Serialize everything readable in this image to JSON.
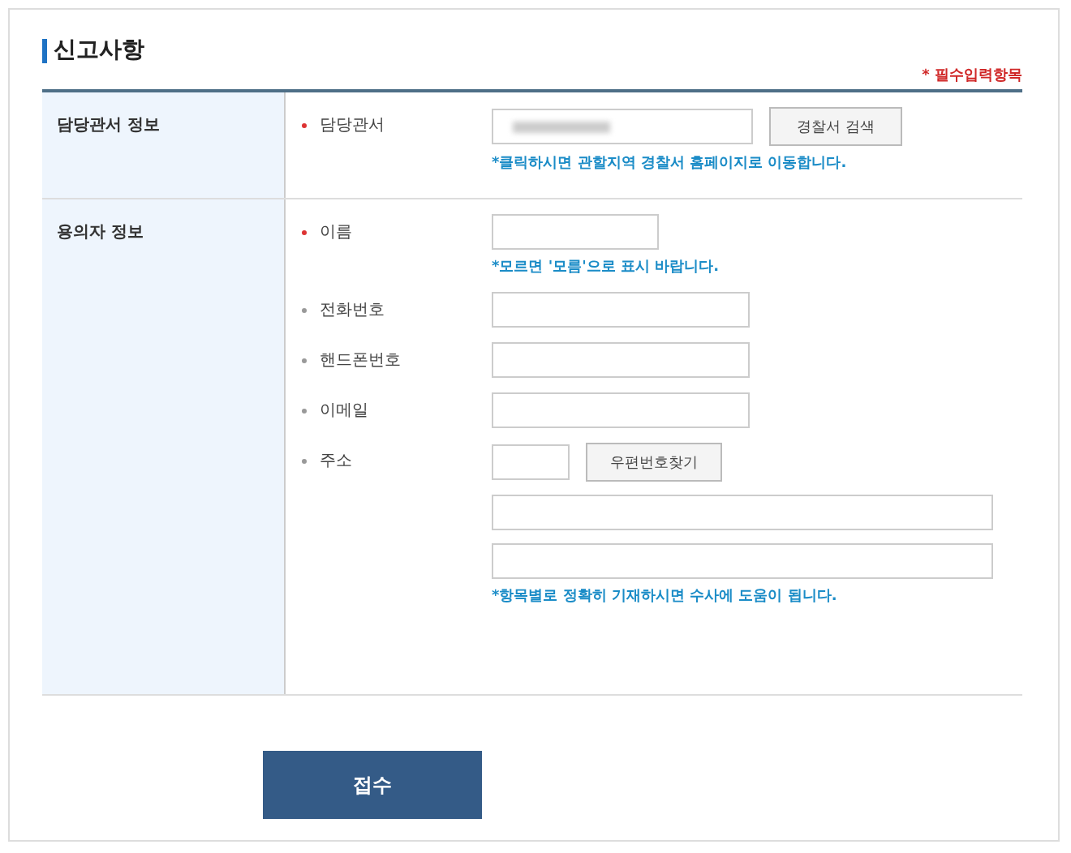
{
  "title": "신고사항",
  "required_note": "* 필수입력항목",
  "sections": [
    {
      "label": "담당관서 정보",
      "fields": [
        {
          "kind": "station",
          "label": "담당관서",
          "required": true,
          "value_hidden": true,
          "button": "경찰서 검색",
          "help": "*클릭하시면 관할지역 경찰서 홈페이지로 이동합니다."
        }
      ]
    },
    {
      "label": "용의자 정보",
      "fields": [
        {
          "kind": "name",
          "label": "이름",
          "required": true,
          "help": "*모르면 '모름'으로 표시 바랍니다."
        },
        {
          "kind": "text",
          "label": "전화번호",
          "required": false
        },
        {
          "kind": "text",
          "label": "핸드폰번호",
          "required": false
        },
        {
          "kind": "text",
          "label": "이메일",
          "required": false
        },
        {
          "kind": "address",
          "label": "주소",
          "required": false,
          "button": "우편번호찾기",
          "help": "*항목별로 정확히 기재하시면 수사에 도움이 됩니다."
        }
      ]
    }
  ],
  "submit": "접수"
}
